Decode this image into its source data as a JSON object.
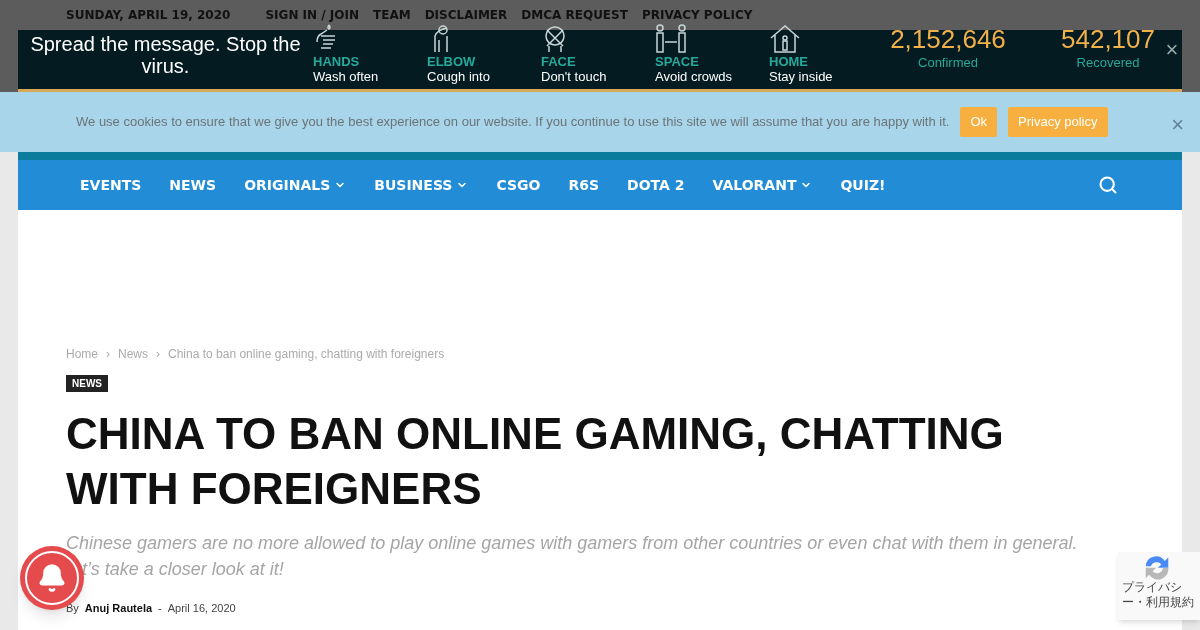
{
  "top_bar": {
    "date": "SUNDAY, APRIL 19, 2020",
    "links": [
      "SIGN IN / JOIN",
      "TEAM",
      "DISCLAIMER",
      "DMCA REQUEST",
      "PRIVACY POLICY"
    ]
  },
  "covid_banner": {
    "message": "Spread the message. Stop the virus.",
    "tips": [
      {
        "kind": "hand",
        "title": "HANDS",
        "text": "Wash often"
      },
      {
        "kind": "elbow",
        "title": "ELBOW",
        "text": "Cough into"
      },
      {
        "kind": "face",
        "title": "FACE",
        "text": "Don't touch"
      },
      {
        "kind": "space",
        "title": "SPACE",
        "text": "Avoid crowds"
      },
      {
        "kind": "home",
        "title": "HOME",
        "text": "Stay inside"
      }
    ],
    "stats": [
      {
        "value": "2,152,646",
        "label": "Confirmed"
      },
      {
        "value": "542,107",
        "label": "Recovered"
      }
    ],
    "close": "×"
  },
  "cookie_notice": {
    "text": "We use cookies to ensure that we give you the best experience on our website. If you continue to use this site we will assume that you are happy with it.",
    "buttons": [
      "Ok",
      "Privacy policy"
    ],
    "close": "×"
  },
  "nav": {
    "items": [
      {
        "label": "EVENTS",
        "dropdown": false
      },
      {
        "label": "NEWS",
        "dropdown": false
      },
      {
        "label": "ORIGINALS",
        "dropdown": true
      },
      {
        "label": "BUSINESS",
        "dropdown": true
      },
      {
        "label": "CSGO",
        "dropdown": false
      },
      {
        "label": "R6S",
        "dropdown": false
      },
      {
        "label": "DOTA 2",
        "dropdown": false
      },
      {
        "label": "VALORANT",
        "dropdown": true
      },
      {
        "label": "QUIZ!",
        "dropdown": false
      }
    ]
  },
  "article": {
    "breadcrumbs": [
      "Home",
      "News",
      "China to ban online gaming, chatting with foreigners"
    ],
    "breadcrumb_separator": "›",
    "category": "NEWS",
    "title": "CHINA TO BAN ONLINE GAMING, CHATTING WITH FOREIGNERS",
    "subtitle_lines": [
      "Chinese gamers are no more allowed to play online games with gamers from other countries or even chat with them in general.",
      "t’s take a closer look at it!"
    ],
    "by": "By",
    "author": "Anuj Rautela",
    "separator": "-",
    "date": "April 16, 2020"
  },
  "recaptcha": {
    "text": "プライバシー・利用規約"
  }
}
